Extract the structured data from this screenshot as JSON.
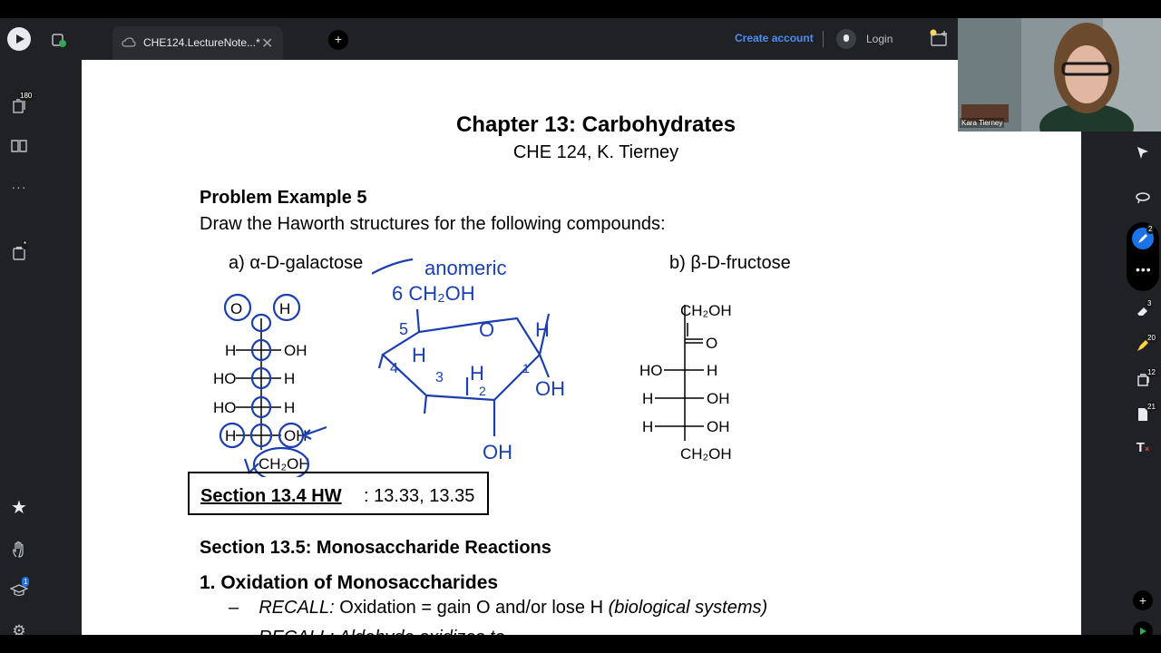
{
  "topbar": {
    "tab_title": "CHE124.LectureNote...*",
    "create_account": "Create account",
    "login": "Login"
  },
  "leftbar": {
    "pages_badge": "180",
    "more": "···",
    "clipboard_badge": "*",
    "courses_badge": "1"
  },
  "rightbar": {
    "pen_badge": "2",
    "eraser_badge": "3",
    "highlighter_badge": "20",
    "layers_badge": "12",
    "pages_badge": "21",
    "text_tool": "T"
  },
  "video": {
    "name": "Kara Tierney"
  },
  "document": {
    "title": "Chapter 13: Carbohydrates",
    "subtitle": "CHE 124, K. Tierney",
    "problem_heading": "Problem Example 5",
    "problem_text": "Draw the Haworth structures for the following compounds:",
    "part_a": "a)  α-D-galactose",
    "part_b": "b) β-D-fructose",
    "hw_label": "Section 13.4 HW",
    "hw_values": ": 13.33, 13.35",
    "section_heading": "Section 13.5: Monosaccharide Reactions",
    "item_1": "1.   Oxidation of Monosaccharides",
    "recall_dash": "–",
    "recall_label": "RECALL:",
    "recall_text": " Oxidation = gain O and/or lose H ",
    "recall_note": "(biological systems)",
    "recall_next": "RECALL: Aldehyde oxidizes to",
    "fructose": {
      "top": "CH₂OH",
      "carbonyl": "O",
      "row1_left": "HO",
      "row1_right": "H",
      "row2_left": "H",
      "row2_right": "OH",
      "row3_left": "H",
      "row3_right": "OH",
      "bottom": "CH₂OH"
    },
    "galactose": {
      "top_left": "O",
      "top_right": "H",
      "row1_left": "H",
      "row1_right": "OH",
      "row2_left": "HO",
      "row2_right": "H",
      "row3_left": "HO",
      "row3_right": "H",
      "row4_left": "H",
      "row4_right": "OH",
      "bottom": "CH₂OH"
    },
    "handwriting": {
      "anomeric": "anomeric",
      "ch2oh": "6 CH₂OH",
      "ring_o": "O",
      "h_right": "H",
      "oh_right": "OH",
      "oh_bottom": "OH",
      "h_mid": "H",
      "h_left": "H",
      "num5": "5",
      "num4": "4",
      "num3": "3",
      "num2": "2",
      "num1": "1"
    }
  }
}
